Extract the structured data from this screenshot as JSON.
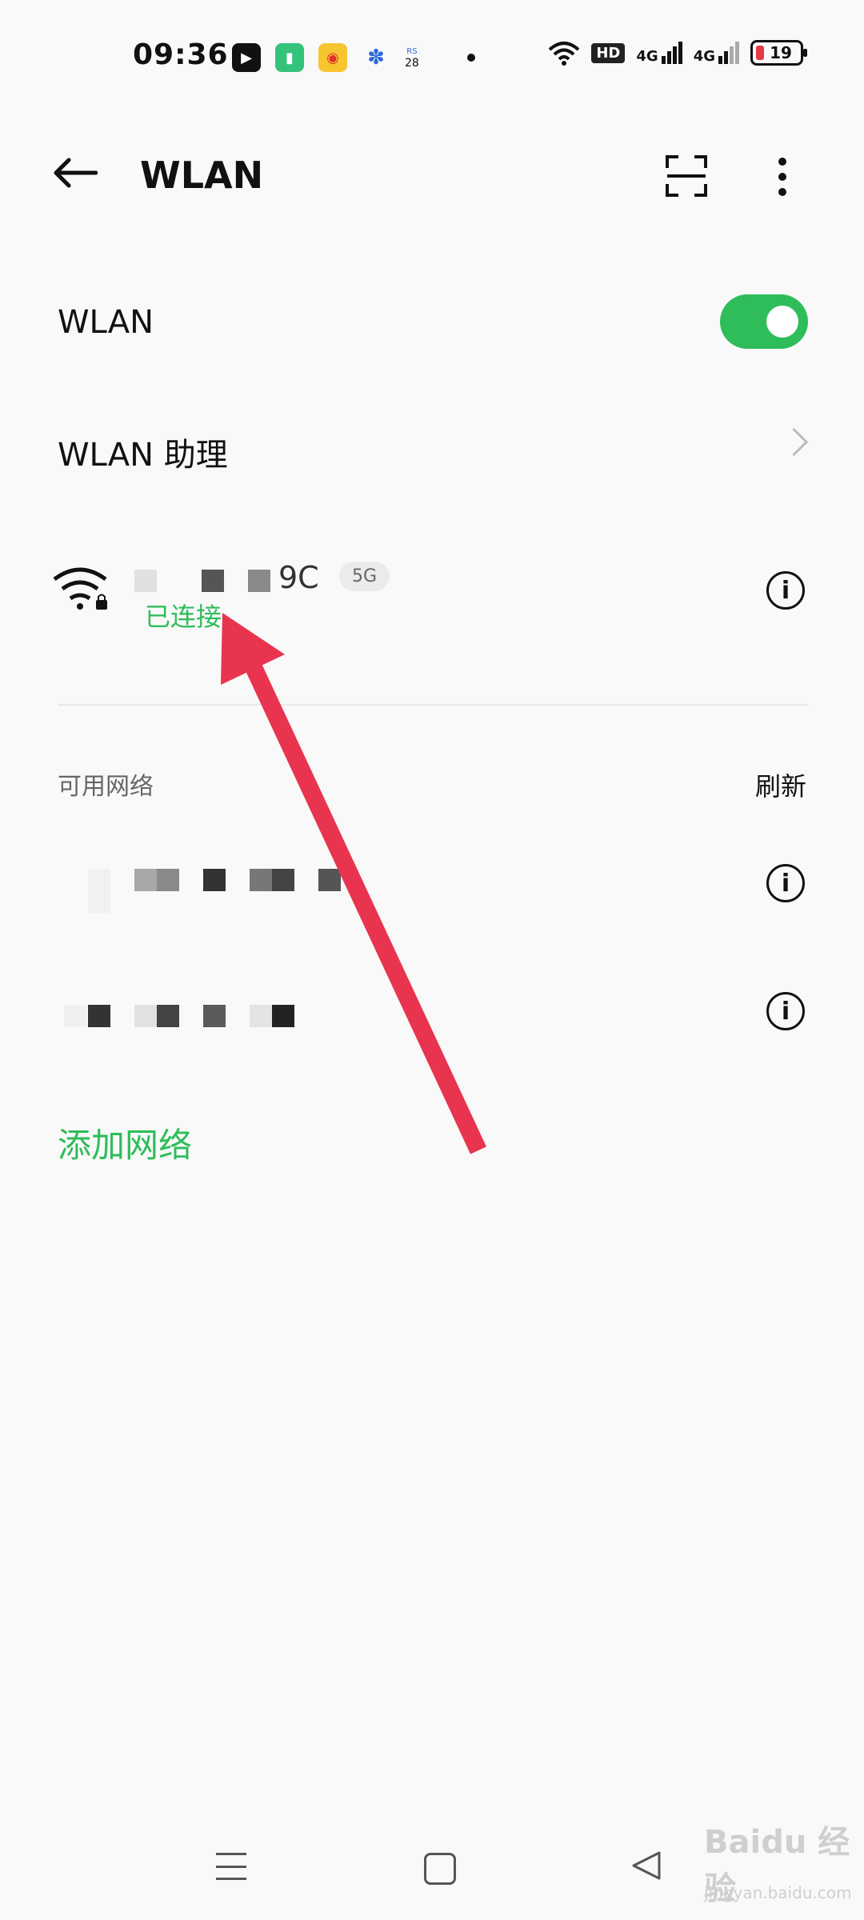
{
  "status_bar": {
    "time": "09:36",
    "battery_level": "19",
    "network_1": "4G",
    "network_2": "4G",
    "hd_label": "HD",
    "badge_small_top": "RS",
    "badge_small_bottom": "28"
  },
  "app_bar": {
    "title": "WLAN"
  },
  "settings": {
    "wlan_label": "WLAN",
    "wlan_enabled": true,
    "assistant_label": "WLAN 助理"
  },
  "connected_network": {
    "name_visible_suffix": "9C",
    "band_tag": "5G",
    "status": "已连接"
  },
  "available_networks": {
    "section_title": "可用网络",
    "refresh_label": "刷新",
    "add_label": "添加网络"
  },
  "watermark": {
    "brand": "Baidu 经验",
    "url": "jingyan.baidu.com"
  },
  "colors": {
    "accent": "#2ebd59",
    "arrow": "#e8344e",
    "background": "#f9f9f9"
  }
}
